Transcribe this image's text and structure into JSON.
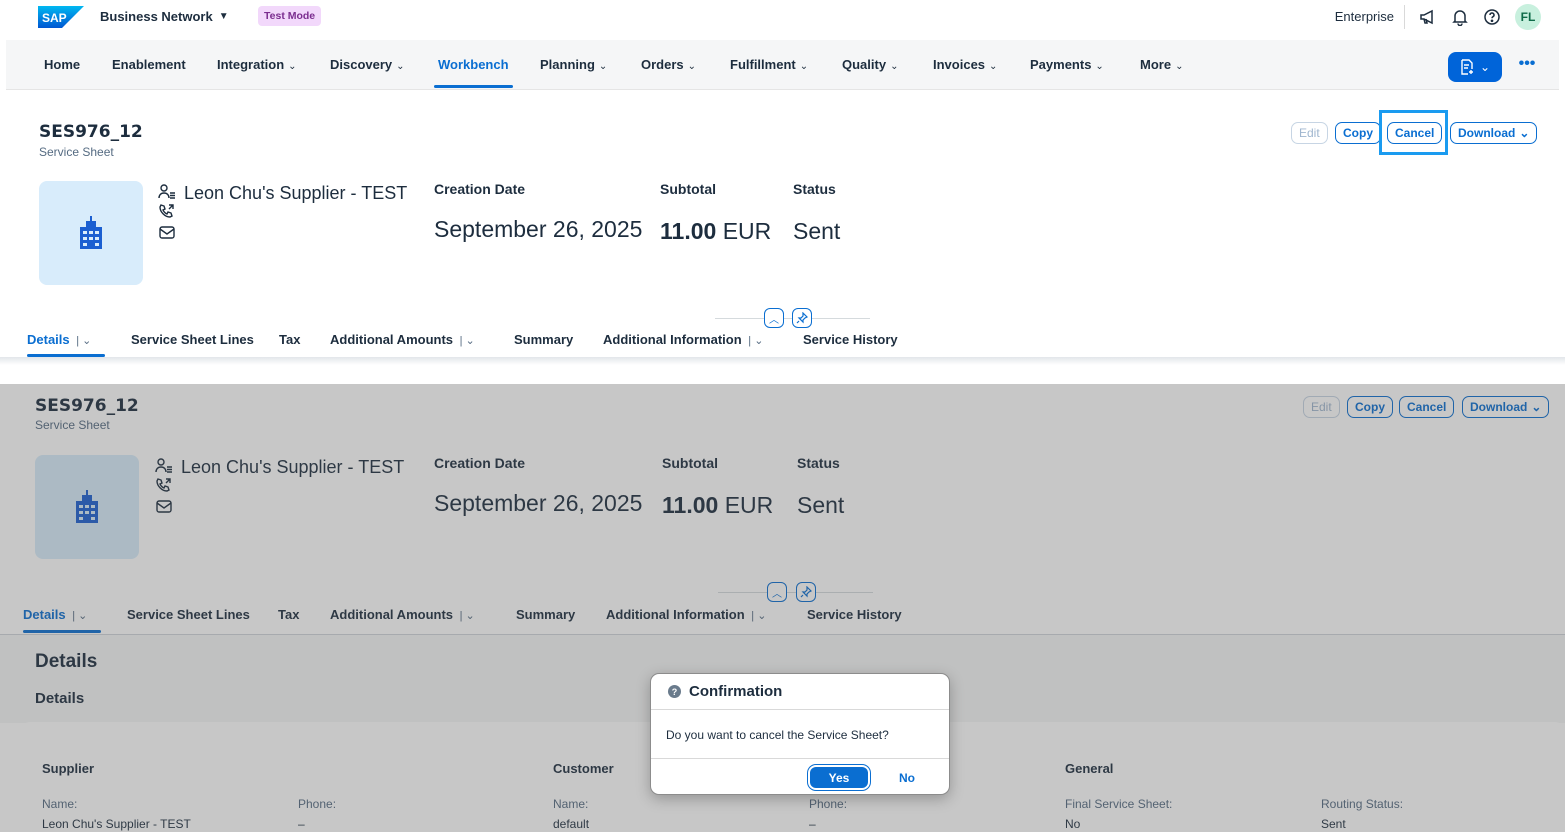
{
  "shell": {
    "logo_text": "SAP",
    "app_name": "Business Network",
    "test_badge": "Test Mode",
    "account": "Enterprise",
    "avatar_initials": "FL"
  },
  "nav": {
    "items": [
      {
        "label": "Home",
        "chevron": ""
      },
      {
        "label": "Enablement",
        "chevron": ""
      },
      {
        "label": "Integration",
        "chevron": "⌄"
      },
      {
        "label": "Discovery",
        "chevron": "⌄"
      },
      {
        "label": "Workbench",
        "chevron": ""
      },
      {
        "label": "Planning",
        "chevron": "⌄"
      },
      {
        "label": "Orders",
        "chevron": "⌄"
      },
      {
        "label": "Fulfillment",
        "chevron": "⌄"
      },
      {
        "label": "Quality",
        "chevron": "⌄"
      },
      {
        "label": "Invoices",
        "chevron": "⌄"
      },
      {
        "label": "Payments",
        "chevron": "⌄"
      },
      {
        "label": "More",
        "chevron": "⌄"
      }
    ],
    "active": "Workbench",
    "more_label": "•••"
  },
  "object": {
    "title": "SES976_12",
    "subtitle": "Service Sheet",
    "actions": {
      "edit": "Edit",
      "copy": "Copy",
      "cancel": "Cancel",
      "download": "Download"
    },
    "contact_name": "Leon Chu's Supplier - TEST",
    "kpis": [
      {
        "label": "Creation Date",
        "value": "September 26, 2025",
        "unit": ""
      },
      {
        "label": "Subtotal",
        "value": "11.00",
        "unit": "EUR"
      },
      {
        "label": "Status",
        "value": "Sent",
        "unit": ""
      }
    ]
  },
  "tabs": [
    {
      "label": "Details",
      "dropdown": true
    },
    {
      "label": "Service Sheet Lines",
      "dropdown": false
    },
    {
      "label": "Tax",
      "dropdown": false
    },
    {
      "label": "Additional Amounts",
      "dropdown": true
    },
    {
      "label": "Summary",
      "dropdown": false
    },
    {
      "label": "Additional Information",
      "dropdown": true
    },
    {
      "label": "Service History",
      "dropdown": false
    }
  ],
  "tab_separator": "|",
  "details": {
    "section_title": "Details",
    "subsection_title": "Details",
    "supplier": {
      "heading": "Supplier",
      "name_label": "Name:",
      "name_value": "Leon Chu's Supplier - TEST",
      "phone_label": "Phone:",
      "phone_value": "–"
    },
    "customer": {
      "heading": "Customer",
      "name_label": "Name:",
      "name_value": "default",
      "phone_label": "Phone:",
      "phone_value": "–"
    },
    "general": {
      "heading": "General",
      "final_label": "Final Service Sheet:",
      "final_value": "No",
      "routing_label": "Routing Status:",
      "routing_value": "Sent"
    }
  },
  "dialog": {
    "title": "Confirmation",
    "message": "Do you want to cancel the Service Sheet?",
    "yes": "Yes",
    "no": "No"
  },
  "colors": {
    "accent": "#0a6ed1",
    "highlight_box": "#1a9bf0",
    "tile_bg": "#d8ecfb",
    "badge_bg": "#f2d8fb"
  }
}
